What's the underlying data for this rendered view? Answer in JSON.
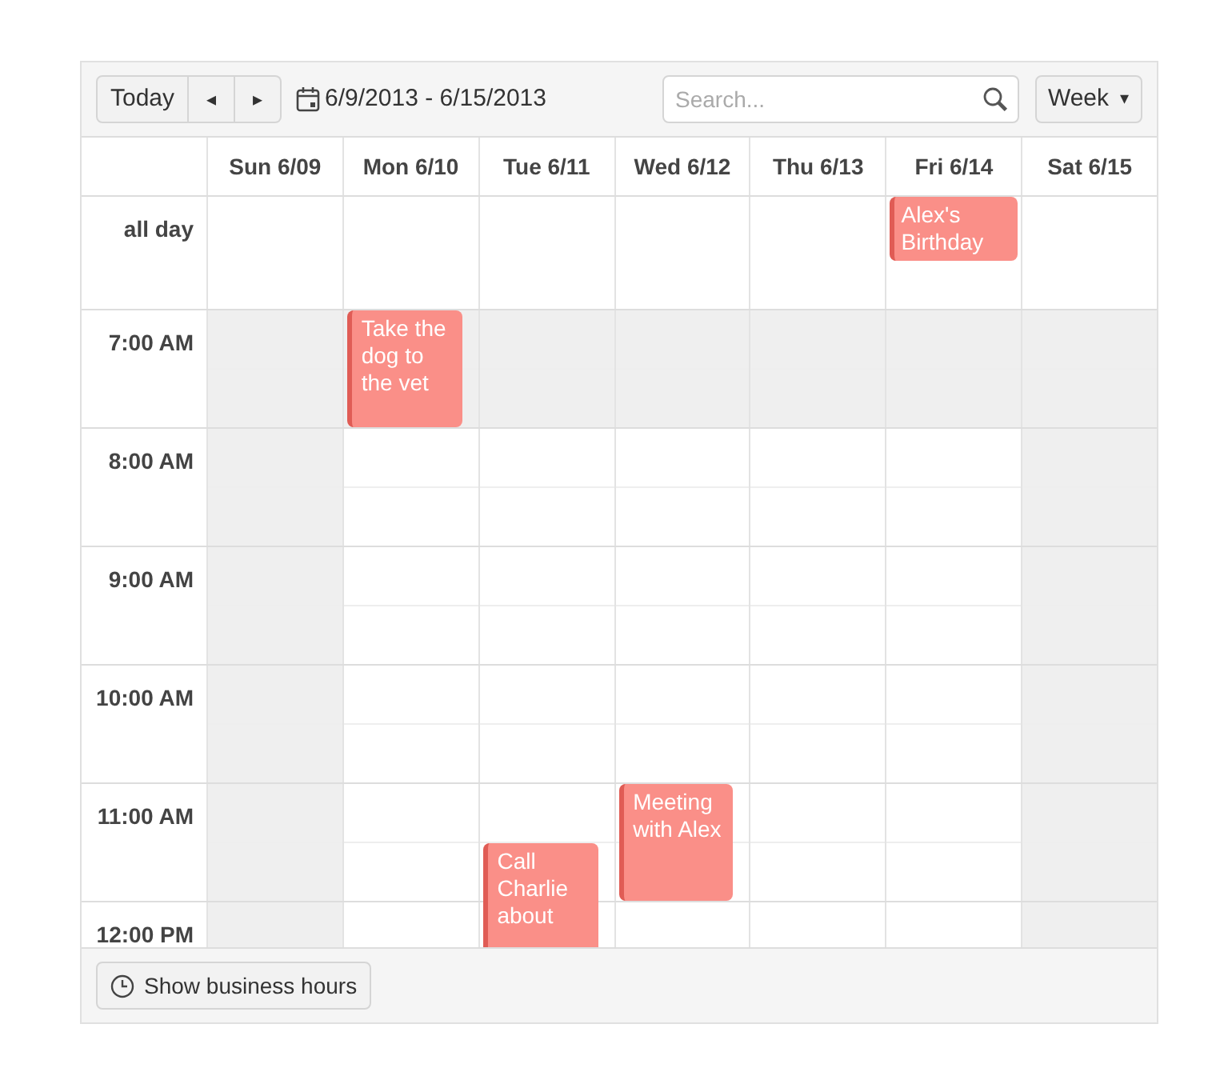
{
  "toolbar": {
    "today": "Today",
    "prev": "◂",
    "next": "▸",
    "date_range": "6/9/2013 - 6/15/2013",
    "search": {
      "placeholder": "Search..."
    },
    "view": "Week",
    "view_caret": "▾"
  },
  "all_day_label": "all day",
  "days": [
    {
      "label": "Sun 6/09"
    },
    {
      "label": "Mon 6/10"
    },
    {
      "label": "Tue 6/11"
    },
    {
      "label": "Wed 6/12"
    },
    {
      "label": "Thu 6/13"
    },
    {
      "label": "Fri 6/14",
      "all_day_events": [
        {
          "title": "Alex's Birthday"
        }
      ]
    },
    {
      "label": "Sat 6/15"
    }
  ],
  "hours": [
    {
      "label": "7:00 AM",
      "cells": [
        {
          "shaded": true
        },
        {
          "shaded": true,
          "events": [
            {
              "title": "Take the dog to the vet",
              "half_past": false
            }
          ]
        },
        {
          "shaded": true
        },
        {
          "shaded": true
        },
        {
          "shaded": true
        },
        {
          "shaded": true
        },
        {
          "shaded": true
        }
      ]
    },
    {
      "label": "8:00 AM",
      "cells": [
        {
          "shaded": true
        },
        {
          "shaded": false
        },
        {
          "shaded": false
        },
        {
          "shaded": false
        },
        {
          "shaded": false
        },
        {
          "shaded": false
        },
        {
          "shaded": true
        }
      ]
    },
    {
      "label": "9:00 AM",
      "cells": [
        {
          "shaded": true
        },
        {
          "shaded": false
        },
        {
          "shaded": false
        },
        {
          "shaded": false
        },
        {
          "shaded": false
        },
        {
          "shaded": false
        },
        {
          "shaded": true
        }
      ]
    },
    {
      "label": "10:00 AM",
      "cells": [
        {
          "shaded": true
        },
        {
          "shaded": false
        },
        {
          "shaded": false
        },
        {
          "shaded": false
        },
        {
          "shaded": false
        },
        {
          "shaded": false
        },
        {
          "shaded": true
        }
      ]
    },
    {
      "label": "11:00 AM",
      "cells": [
        {
          "shaded": true
        },
        {
          "shaded": false
        },
        {
          "shaded": false,
          "events": [
            {
              "title": "Call Charlie about",
              "half_past": true
            }
          ]
        },
        {
          "shaded": false,
          "events": [
            {
              "title": "Meeting with Alex",
              "half_past": false
            }
          ]
        },
        {
          "shaded": false
        },
        {
          "shaded": false
        },
        {
          "shaded": true
        }
      ]
    },
    {
      "label": "12:00 PM",
      "cells": [
        {
          "shaded": true
        },
        {
          "shaded": false
        },
        {
          "shaded": false
        },
        {
          "shaded": false
        },
        {
          "shaded": false
        },
        {
          "shaded": false
        },
        {
          "shaded": true
        }
      ]
    }
  ],
  "footer": {
    "business_hours_button": "Show business hours"
  }
}
